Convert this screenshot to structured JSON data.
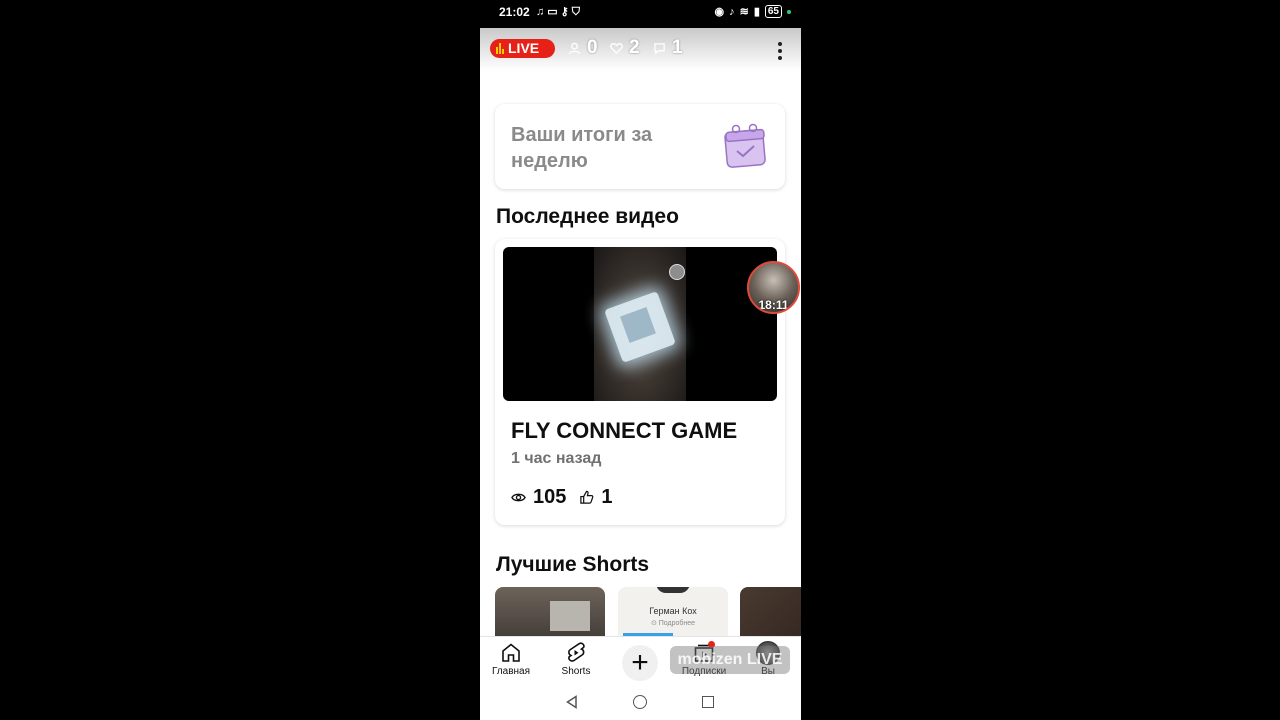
{
  "status_bar": {
    "time": "21:02",
    "battery": "65",
    "left_icons": [
      "headphones-icon",
      "cast-icon",
      "key-icon",
      "shield-icon"
    ],
    "right_icons": [
      "eye-icon",
      "mute-icon",
      "wifi-icon",
      "signal-icon",
      "battery-icon"
    ]
  },
  "live_header": {
    "live_label": "LIVE",
    "viewers": "0",
    "likes": "2",
    "comments": "1"
  },
  "weekly_card": {
    "text": "Ваши итоги за неделю",
    "icon": "calendar-check-icon"
  },
  "latest_video": {
    "section_title": "Последнее видео",
    "title": "FLY CONNECT GAME",
    "time_ago": "1 час назад",
    "views": "105",
    "likes": "1"
  },
  "floating_avatar": {
    "timer": "18:11"
  },
  "best_shorts": {
    "section_title": "Лучшие Shorts",
    "items": [
      {
        "caption": ""
      },
      {
        "caption": "Герман Кох",
        "sub": "⊙ Подробнее"
      },
      {
        "caption": ""
      }
    ]
  },
  "bottom_nav": {
    "items": [
      {
        "label": "Главная",
        "icon": "home-icon"
      },
      {
        "label": "Shorts",
        "icon": "shorts-icon"
      },
      {
        "label": "",
        "icon": "plus-icon"
      },
      {
        "label": "Подписки",
        "icon": "subscriptions-icon"
      },
      {
        "label": "Вы",
        "icon": "avatar-icon"
      }
    ]
  },
  "watermark": "mobizen LIVE",
  "colors": {
    "live_red": "#e62117",
    "text_primary": "#0f0f0f",
    "text_secondary": "#717171",
    "weekly_icon": "#c9a8e8"
  }
}
